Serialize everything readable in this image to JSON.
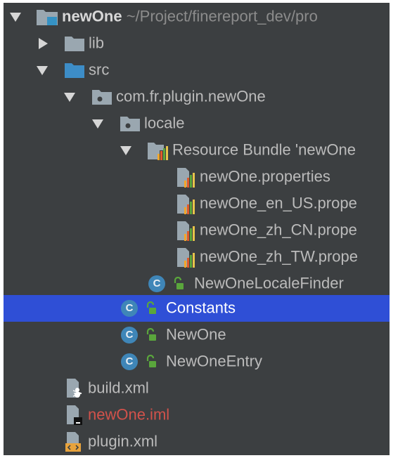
{
  "tree": {
    "rows": [
      {
        "label": "newOne",
        "path": "~/Project/finereport_dev/pro",
        "icon": "module-folder-icon"
      },
      {
        "label": "lib",
        "icon": "folder-icon"
      },
      {
        "label": "src",
        "icon": "source-folder-icon"
      },
      {
        "label": "com.fr.plugin.newOne",
        "icon": "package-icon"
      },
      {
        "label": "locale",
        "icon": "package-icon"
      },
      {
        "label": "Resource Bundle 'newOne",
        "icon": "resource-bundle-icon"
      },
      {
        "label": "newOne.properties",
        "icon": "properties-file-icon"
      },
      {
        "label": "newOne_en_US.prope",
        "icon": "properties-file-icon"
      },
      {
        "label": "newOne_zh_CN.prope",
        "icon": "properties-file-icon"
      },
      {
        "label": "newOne_zh_TW.prope",
        "icon": "properties-file-icon"
      },
      {
        "label": "NewOneLocaleFinder",
        "icon": "class-icon"
      },
      {
        "label": "Constants",
        "icon": "class-icon",
        "selected": true
      },
      {
        "label": "NewOne",
        "icon": "class-icon"
      },
      {
        "label": "NewOneEntry",
        "icon": "class-icon"
      },
      {
        "label": "build.xml",
        "icon": "ant-build-file-icon"
      },
      {
        "label": "newOne.iml",
        "icon": "iml-file-icon"
      },
      {
        "label": "plugin.xml",
        "icon": "xml-file-icon"
      }
    ],
    "class_badge_letter": "C",
    "selection_color": "#2f4fd6",
    "unversioned_file_color": "#d2524b"
  }
}
